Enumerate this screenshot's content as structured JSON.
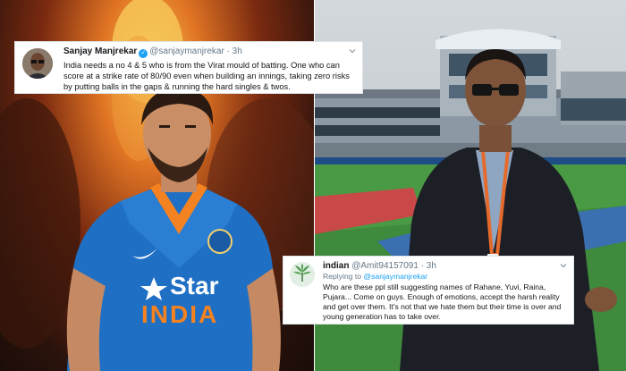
{
  "tweet1": {
    "name": "Sanjay Manjrekar",
    "handle": "@sanjaymanjrekar",
    "time": "· 3h",
    "text": "India needs a no 4 & 5 who is from the Virat mould of batting. One who can score at a strike rate of 80/90 even when building an innings, taking zero risks by putting balls in the gaps & running the hard singles & twos."
  },
  "tweet2": {
    "name": "indian",
    "handle": "@Amit94157091",
    "time": "· 3h",
    "replying_prefix": "Replying to",
    "replying_to": "@sanjaymanjrekar",
    "text": "Who are these ppl still suggesting names of Rahane, Yuvi, Raina, Pujara... Come on guys. Enough of emotions, accept the harsh reality and get over them. It's not that we hate them but their time is over and young generation has to take over."
  },
  "photo_left": {
    "jersey_sponsor": "Star",
    "jersey_country": "INDIA",
    "colors": {
      "jersey": "#1f6fc4",
      "flame": "#f6b53f",
      "sponsor_orange": "#f58220"
    }
  },
  "photo_right": {
    "colors": {
      "sky": "#cdd2d6",
      "grass": "#3f8a3d",
      "jacket": "#1d1f26"
    }
  },
  "icons": {
    "verified": "verified-badge-icon",
    "caret": "chevron-down-icon",
    "avatar2": "leaf-icon"
  }
}
